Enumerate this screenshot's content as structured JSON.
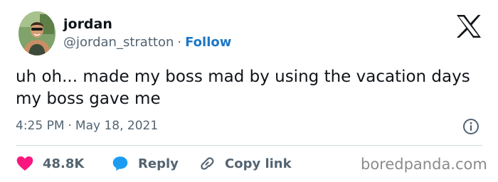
{
  "author": {
    "name": "jordan",
    "handle": "@jordan_stratton",
    "separator": "·",
    "follow_label": "Follow"
  },
  "tweet": {
    "text": "uh oh... made my boss mad by using the vacation days my boss gave me",
    "time": "4:25 PM",
    "separator": "·",
    "date": "May 18, 2021"
  },
  "actions": {
    "likes_count": "48.8K",
    "reply_label": "Reply",
    "copy_link_label": "Copy link"
  },
  "watermark": "boredpanda.com",
  "icons": {
    "brand": "x-logo-icon",
    "info": "info-icon",
    "like": "heart-icon",
    "reply": "speech-bubble-icon",
    "copy": "link-icon"
  },
  "colors": {
    "like": "#f91880",
    "reply": "#1d9bf0",
    "link": "#1d77c5",
    "text": "#0f1419",
    "muted": "#536471"
  }
}
